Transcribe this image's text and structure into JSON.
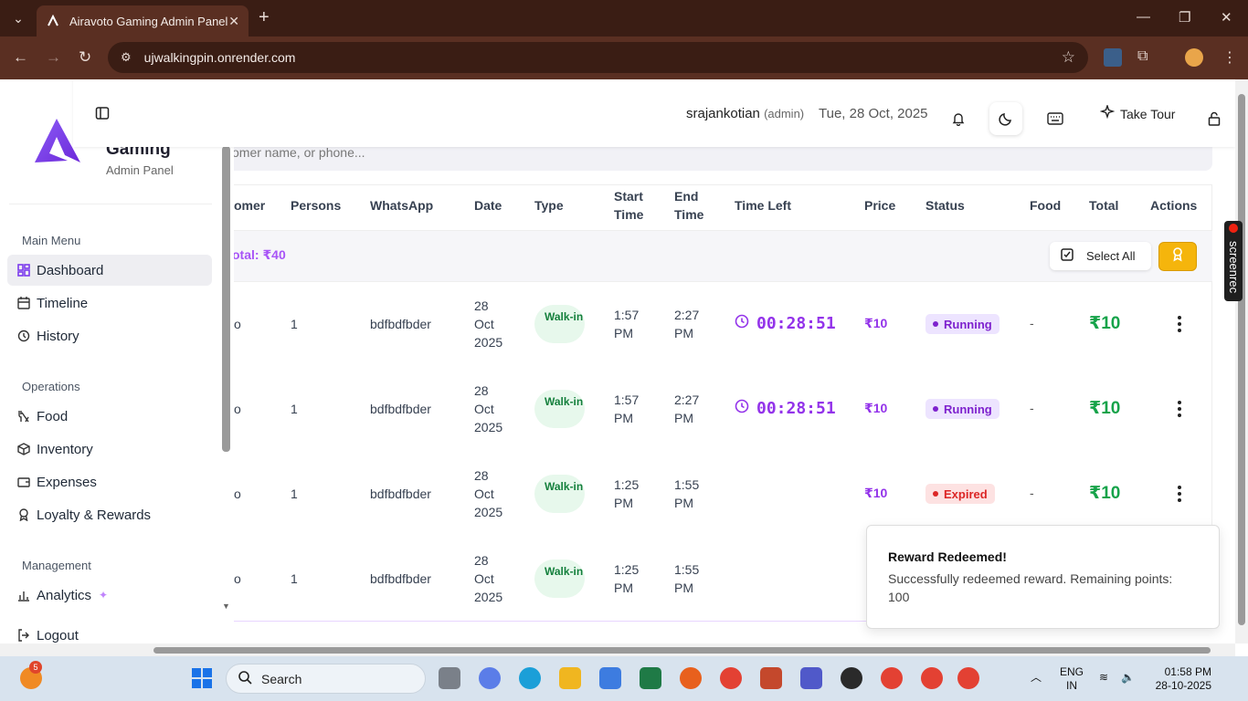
{
  "browser": {
    "tab_title": "Airavoto Gaming Admin Panel",
    "url": "ujwalkingpin.onrender.com"
  },
  "sidebar": {
    "brand_name": "Gaming",
    "brand_subtitle": "Admin Panel",
    "sections": [
      {
        "title": "Main Menu",
        "items": [
          {
            "label": "Dashboard",
            "icon": "dashboard-icon",
            "active": true
          },
          {
            "label": "Timeline",
            "icon": "calendar-icon"
          },
          {
            "label": "History",
            "icon": "history-icon"
          }
        ]
      },
      {
        "title": "Operations",
        "items": [
          {
            "label": "Food",
            "icon": "utensils-icon"
          },
          {
            "label": "Inventory",
            "icon": "box-icon"
          },
          {
            "label": "Expenses",
            "icon": "wallet-icon"
          },
          {
            "label": "Loyalty & Rewards",
            "icon": "award-icon"
          }
        ]
      },
      {
        "title": "Management",
        "items": [
          {
            "label": "Analytics",
            "icon": "chart-icon"
          },
          {
            "label": "Logout",
            "icon": "logout-icon"
          }
        ]
      }
    ]
  },
  "header": {
    "username": "srajankotian",
    "role": "(admin)",
    "date": "Tue, 28 Oct, 2025",
    "tour_label": "Take Tour"
  },
  "search": {
    "placeholder": "omer name, or phone..."
  },
  "table": {
    "columns": [
      "omer",
      "Persons",
      "WhatsApp",
      "Date",
      "Type",
      "Start Time",
      "End Time",
      "Time Left",
      "Price",
      "Status",
      "Food",
      "Total",
      "Actions"
    ],
    "group_total": "otal: ₹40",
    "select_all": "Select All",
    "rows": [
      {
        "customer": "o",
        "persons": "1",
        "whatsapp": "bdfbdfbder",
        "date": "28 Oct 2025",
        "type": "Walk-in",
        "start": "1:57 PM",
        "end": "2:27 PM",
        "time_left": "00:28:51",
        "price": "₹10",
        "status": "Running",
        "food": "-",
        "total": "₹10"
      },
      {
        "customer": "o",
        "persons": "1",
        "whatsapp": "bdfbdfbder",
        "date": "28 Oct 2025",
        "type": "Walk-in",
        "start": "1:57 PM",
        "end": "2:27 PM",
        "time_left": "00:28:51",
        "price": "₹10",
        "status": "Running",
        "food": "-",
        "total": "₹10"
      },
      {
        "customer": "o",
        "persons": "1",
        "whatsapp": "bdfbdfbder",
        "date": "28 Oct 2025",
        "type": "Walk-in",
        "start": "1:25 PM",
        "end": "1:55 PM",
        "time_left": "",
        "price": "₹10",
        "status": "Expired",
        "food": "-",
        "total": "₹10"
      },
      {
        "customer": "o",
        "persons": "1",
        "whatsapp": "bdfbdfbder",
        "date": "28 Oct 2025",
        "type": "Walk-in",
        "start": "1:25 PM",
        "end": "1:55 PM",
        "time_left": "",
        "price": "",
        "status": "",
        "food": "",
        "total": ""
      }
    ]
  },
  "toast": {
    "title": "Reward Redeemed!",
    "message": "Successfully redeemed reward. Remaining points: 100"
  },
  "overlay": {
    "screenrec": "screenrec"
  },
  "taskbar": {
    "search": "Search",
    "lang": "ENG",
    "region": "IN",
    "time": "01:58 PM",
    "date": "28-10-2025",
    "notif_count": "5"
  },
  "colors": {
    "accent": "#9333ea",
    "success": "#16a34a",
    "danger": "#dc2626",
    "gold": "#f5b50c",
    "chrome": "#3a1d14"
  }
}
